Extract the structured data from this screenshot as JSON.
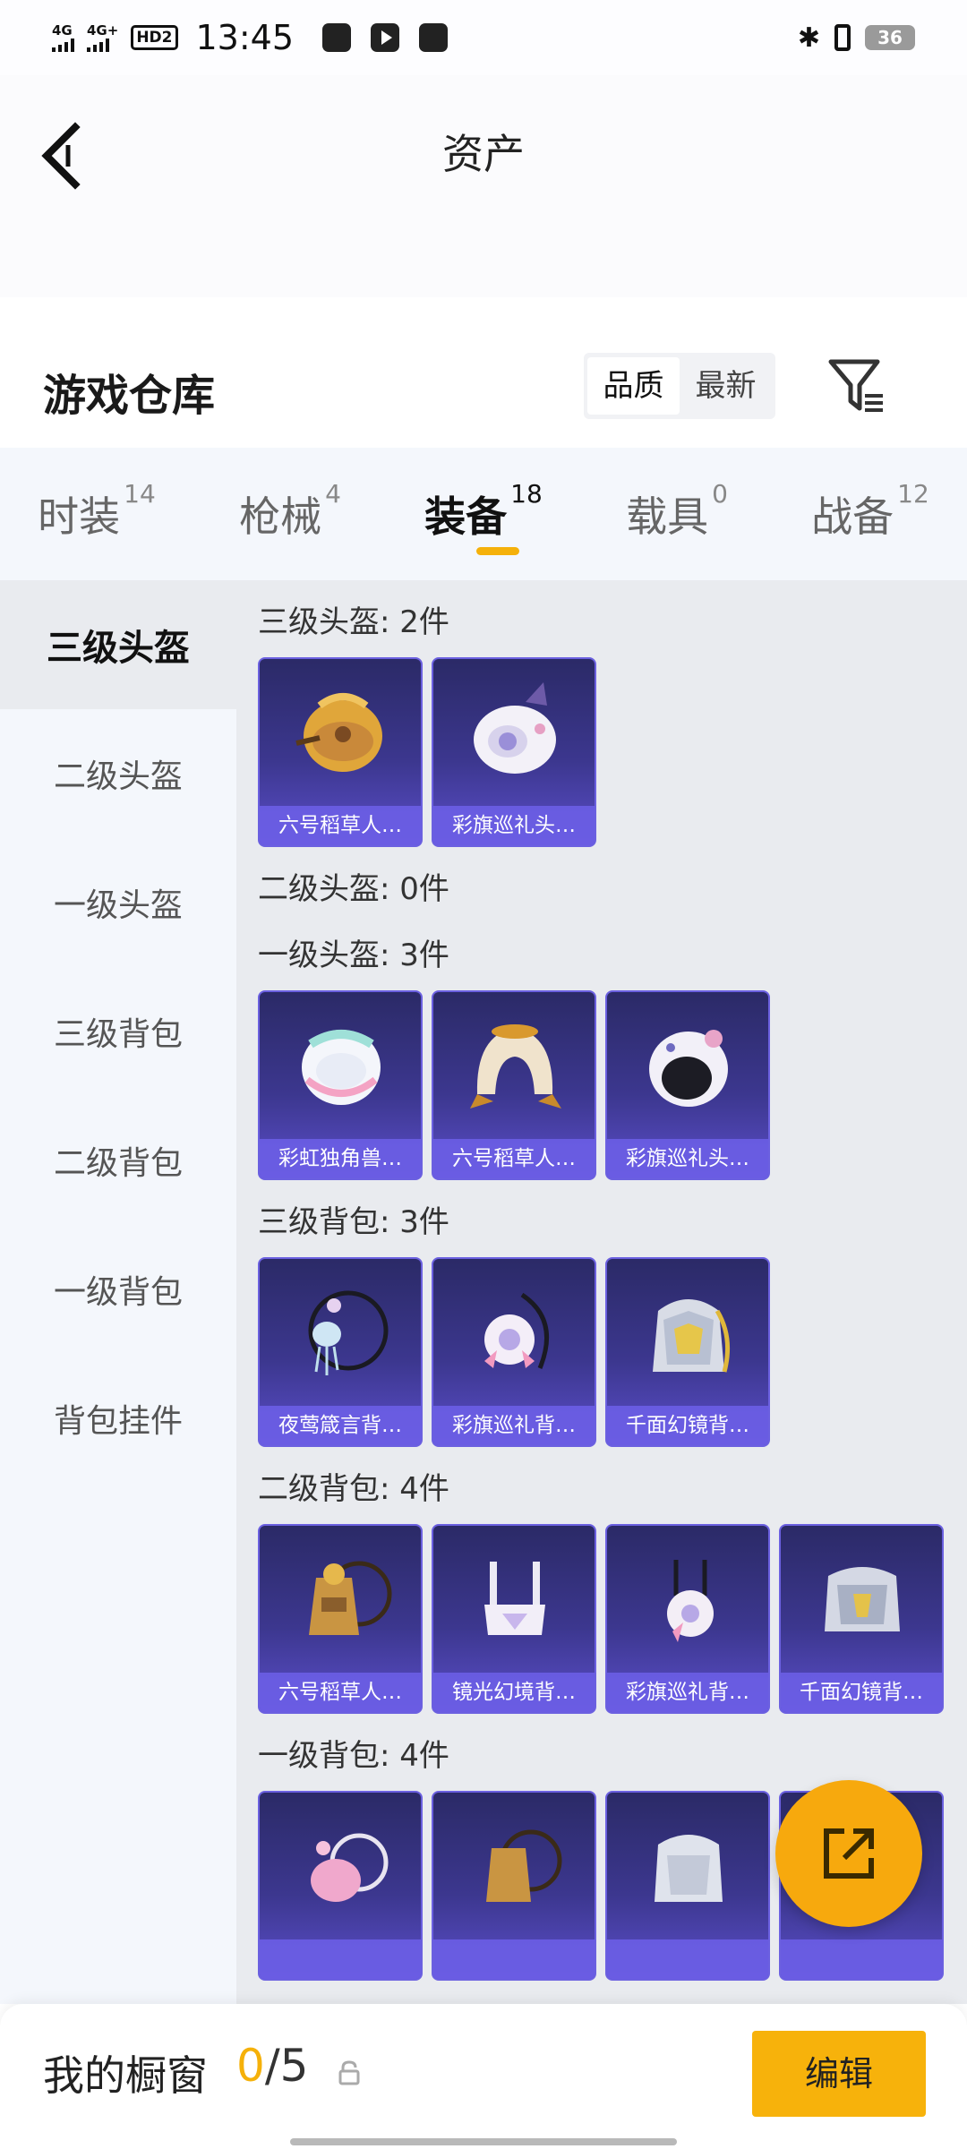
{
  "status_bar": {
    "signal1": "4G",
    "signal2": "4G+",
    "hd": "HD2",
    "time": "13:45",
    "battery": "36"
  },
  "header": {
    "title": "资产"
  },
  "warehouse": {
    "title": "游戏仓库",
    "sort_options": [
      "品质",
      "最新"
    ],
    "sort_selected": "品质"
  },
  "tabs": [
    {
      "label": "时装",
      "count": "14"
    },
    {
      "label": "枪械",
      "count": "4"
    },
    {
      "label": "装备",
      "count": "18",
      "active": true
    },
    {
      "label": "载具",
      "count": "0"
    },
    {
      "label": "战备",
      "count": "12"
    }
  ],
  "sidebar": {
    "items": [
      "三级头盔",
      "二级头盔",
      "一级头盔",
      "三级背包",
      "二级背包",
      "一级背包",
      "背包挂件"
    ],
    "active_index": 0
  },
  "sections": [
    {
      "title": "三级头盔: 2件",
      "items": [
        "六号稻草人…",
        "彩旗巡礼头…"
      ]
    },
    {
      "title": "二级头盔: 0件",
      "items": []
    },
    {
      "title": "一级头盔: 3件",
      "items": [
        "彩虹独角兽…",
        "六号稻草人…",
        "彩旗巡礼头…"
      ]
    },
    {
      "title": "三级背包: 3件",
      "items": [
        "夜莺箴言背…",
        "彩旗巡礼背…",
        "千面幻镜背…"
      ]
    },
    {
      "title": "二级背包: 4件",
      "items": [
        "六号稻草人…",
        "镜光幻境背…",
        "彩旗巡礼背…",
        "千面幻镜背…"
      ]
    },
    {
      "title": "一级背包: 4件",
      "items": [
        "",
        "",
        "",
        ""
      ]
    }
  ],
  "showcase": {
    "label": "我的橱窗",
    "current": "0",
    "separator_total": "/5",
    "edit_label": "编辑"
  },
  "colors": {
    "accent": "#f5b10a",
    "card_bg": "#3c378f",
    "card_label": "#6c5ee6"
  }
}
